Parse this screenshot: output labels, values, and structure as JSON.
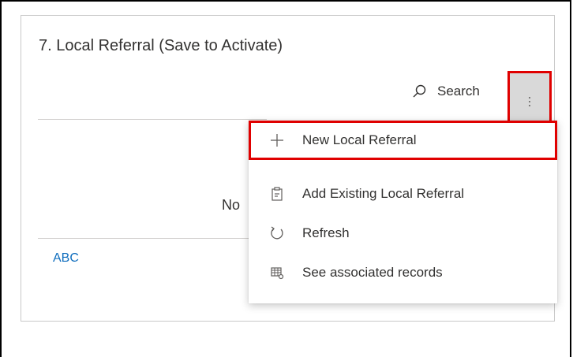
{
  "card": {
    "title": "7. Local Referral (Save to Activate)",
    "search_label": "Search",
    "empty_text": "No",
    "link_text": "ABC"
  },
  "menu": {
    "items": [
      {
        "label": "New Local Referral",
        "icon": "plus-icon"
      },
      {
        "label": "Add Existing Local Referral",
        "icon": "clipboard-icon"
      },
      {
        "label": "Refresh",
        "icon": "refresh-icon"
      },
      {
        "label": "See associated records",
        "icon": "grid-records-icon"
      }
    ]
  },
  "colors": {
    "highlight": "#e00000",
    "link": "#106ebe"
  }
}
